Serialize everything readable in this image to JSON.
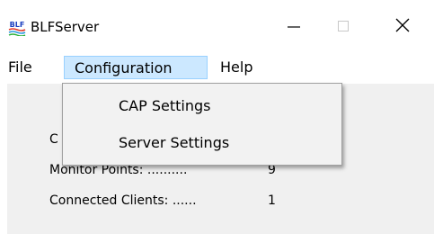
{
  "window": {
    "title": "BLFServer",
    "logo_icon": "blf-logo-icon",
    "logo_text": "BLF",
    "controls": {
      "minimize_icon": "minimize-icon",
      "maximize_icon": "maximize-icon",
      "close_icon": "close-icon"
    }
  },
  "menubar": {
    "items": [
      {
        "label": "File"
      },
      {
        "label": "Configuration",
        "active": true
      },
      {
        "label": "Help"
      }
    ]
  },
  "dropdown": {
    "items": [
      {
        "label": "CAP Settings"
      },
      {
        "label": "Server Settings"
      }
    ]
  },
  "stats": {
    "row1": {
      "label": "C",
      "value": ""
    },
    "row2": {
      "label": "Monitor Points: ..........",
      "value": "9"
    },
    "row3": {
      "label": "Connected Clients: ......",
      "value": "1"
    }
  },
  "colors": {
    "menu_highlight": "#cce8ff",
    "menu_highlight_border": "#99d1ff",
    "client_bg": "#f0f0f0",
    "dropdown_bg": "#f2f2f2"
  }
}
